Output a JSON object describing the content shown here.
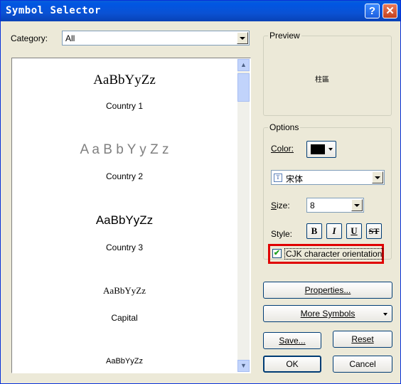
{
  "window": {
    "title": "Symbol Selector",
    "help_icon": "?",
    "close_icon": "✕"
  },
  "category": {
    "label": "Category:",
    "value": "All"
  },
  "symbols": [
    {
      "sample": "AaBbYyZz",
      "name": "Country 1"
    },
    {
      "sample": "A a B b Y y Z z",
      "name": "Country 2"
    },
    {
      "sample": "AaBbYyZz",
      "name": "Country 3"
    },
    {
      "sample": "AaBbYyZz",
      "name": "Capital"
    },
    {
      "sample": "AaBbYyZz",
      "name": ""
    }
  ],
  "preview": {
    "label": "Preview",
    "sample_text": "柱區"
  },
  "options": {
    "label": "Options",
    "color_label": "Color:",
    "color_value": "#000000",
    "font_value": "宋体",
    "size_label": "Size:",
    "size_value": "8",
    "style_label": "Style:",
    "bold": "B",
    "italic": "I",
    "underline": "U",
    "strike": "ST",
    "cjk_label": "CJK character orientation",
    "cjk_checked": true
  },
  "buttons": {
    "properties": "Properties...",
    "more_symbols": "More Symbols",
    "save": "Save...",
    "reset": "Reset",
    "ok": "OK",
    "cancel": "Cancel"
  },
  "colors": {
    "highlight": "#e00000"
  }
}
